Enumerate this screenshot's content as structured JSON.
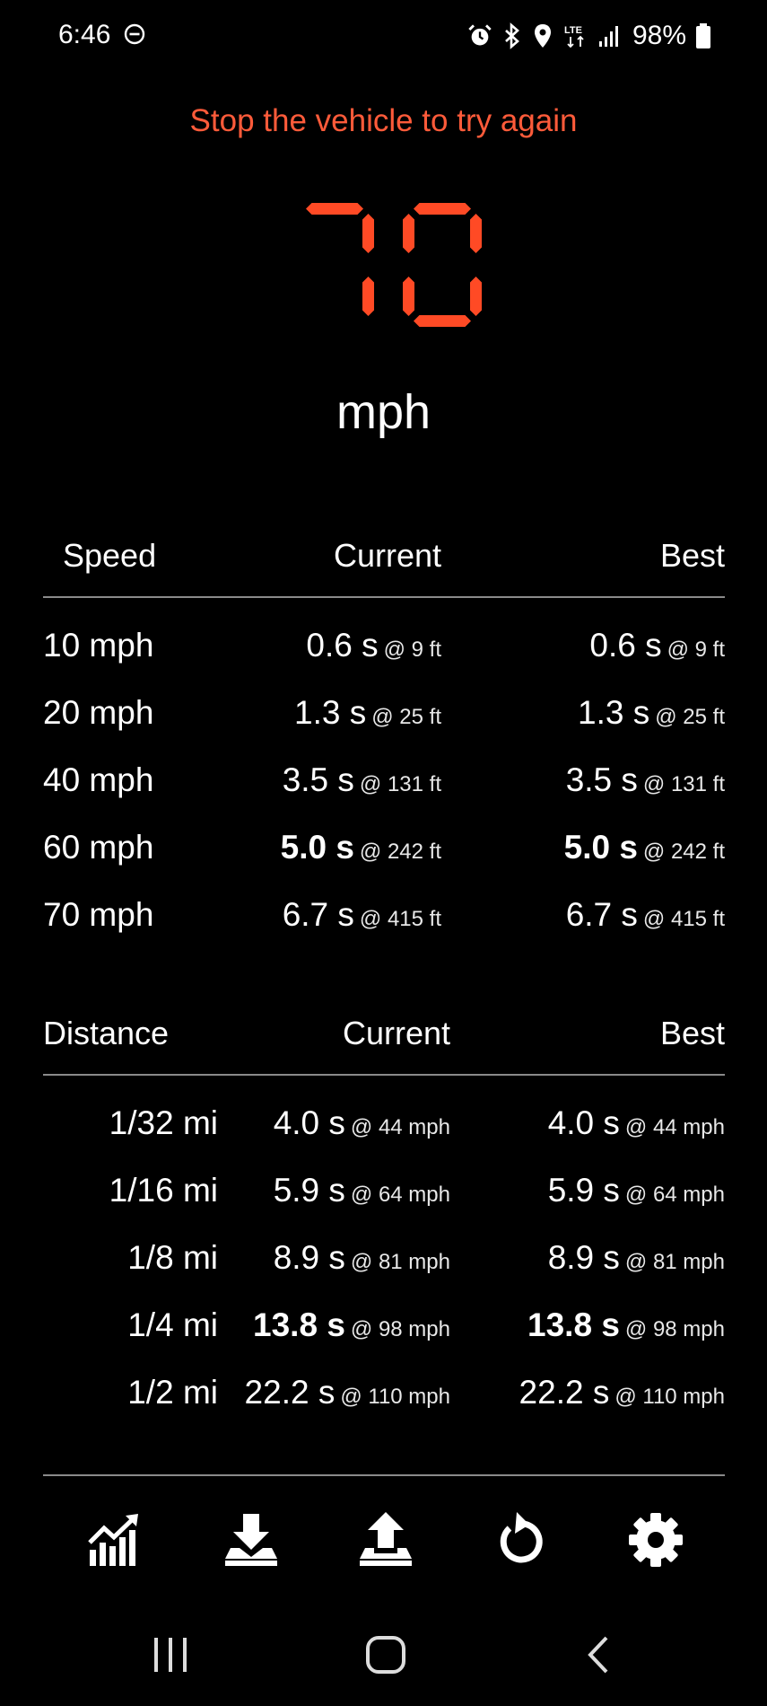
{
  "status_bar": {
    "time": "6:46",
    "battery_text": "98%",
    "network_label": "LTE",
    "icons": [
      "do-not-disturb-icon",
      "alarm-icon",
      "bluetooth-icon",
      "location-icon",
      "lte-icon",
      "signal-icon",
      "battery-icon"
    ]
  },
  "message": "Stop the vehicle to try again",
  "speed": {
    "value": "70",
    "unit": "mph"
  },
  "colors": {
    "accent": "#ff4a25",
    "message": "#ff5b3a",
    "rule": "#8a8a8a",
    "background": "#000000"
  },
  "speed_table": {
    "headers": {
      "label": "Speed",
      "current": "Current",
      "best": "Best"
    },
    "rows": [
      {
        "label": "10 mph",
        "current": "0.6 s",
        "current_at": "@ 9 ft",
        "best": "0.6 s",
        "best_at": "@ 9 ft",
        "bold": false
      },
      {
        "label": "20 mph",
        "current": "1.3 s",
        "current_at": "@ 25 ft",
        "best": "1.3 s",
        "best_at": "@ 25 ft",
        "bold": false
      },
      {
        "label": "40 mph",
        "current": "3.5 s",
        "current_at": "@ 131 ft",
        "best": "3.5 s",
        "best_at": "@ 131 ft",
        "bold": false
      },
      {
        "label": "60 mph",
        "current": "5.0 s",
        "current_at": "@ 242 ft",
        "best": "5.0 s",
        "best_at": "@ 242 ft",
        "bold": true
      },
      {
        "label": "70 mph",
        "current": "6.7 s",
        "current_at": "@ 415 ft",
        "best": "6.7 s",
        "best_at": "@ 415 ft",
        "bold": false
      }
    ]
  },
  "distance_table": {
    "headers": {
      "label": "Distance",
      "current": "Current",
      "best": "Best"
    },
    "rows": [
      {
        "label": "1/32 mi",
        "current": "4.0 s",
        "current_at": "@ 44 mph",
        "best": "4.0 s",
        "best_at": "@ 44 mph",
        "bold": false
      },
      {
        "label": "1/16 mi",
        "current": "5.9 s",
        "current_at": "@ 64 mph",
        "best": "5.9 s",
        "best_at": "@ 64 mph",
        "bold": false
      },
      {
        "label": "1/8 mi",
        "current": "8.9 s",
        "current_at": "@ 81 mph",
        "best": "8.9 s",
        "best_at": "@ 81 mph",
        "bold": false
      },
      {
        "label": "1/4 mi",
        "current": "13.8 s",
        "current_at": "@ 98 mph",
        "best": "13.8 s",
        "best_at": "@ 98 mph",
        "bold": true
      },
      {
        "label": "1/2 mi",
        "current": "22.2 s",
        "current_at": "@ 110 mph",
        "best": "22.2 s",
        "best_at": "@ 110 mph",
        "bold": false
      }
    ]
  },
  "toolbar": {
    "buttons": [
      {
        "icon": "chart-icon",
        "name": "stats-button"
      },
      {
        "icon": "download-icon",
        "name": "import-button"
      },
      {
        "icon": "upload-icon",
        "name": "export-button"
      },
      {
        "icon": "reset-icon",
        "name": "reset-button"
      },
      {
        "icon": "gear-icon",
        "name": "settings-button"
      }
    ]
  },
  "nav_bar": {
    "buttons": [
      "recents-icon",
      "home-icon",
      "back-icon"
    ]
  }
}
